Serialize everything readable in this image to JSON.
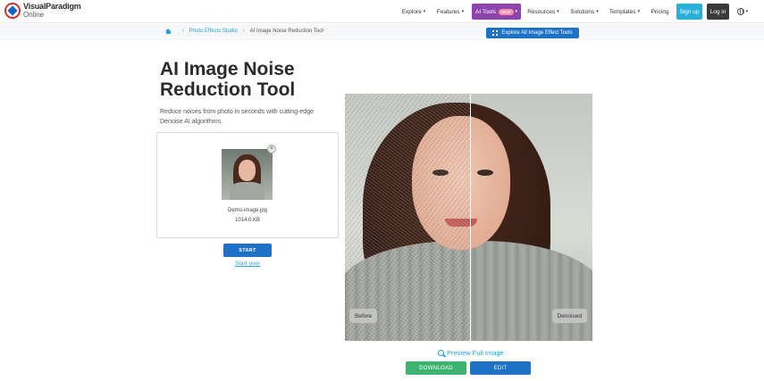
{
  "header": {
    "logo_line1": "VisualParadigm",
    "logo_line2": "Online",
    "nav": {
      "explore": "Explore",
      "features": "Features",
      "ai_tools": "AI Tools",
      "ai_badge": "NEW",
      "resources": "Resources",
      "solutions": "Solutions",
      "templates": "Templates",
      "pricing": "Pricing",
      "signup": "Sign up",
      "login": "Log in"
    }
  },
  "breadcrumb": {
    "item1": "Photo Effects Studio",
    "item2": "AI Image Noise Reduction Tool",
    "explore_button": "Explore All Image Effect Tools"
  },
  "main": {
    "title": "AI Image Noise Reduction Tool",
    "description": "Reduce noises from photo in seconds with cutting-edge Denoise AI algorithms.",
    "file": {
      "name": "Demo-image.jpg",
      "size": "1014.0 KB"
    },
    "start_button": "START",
    "start_over": "Start over"
  },
  "compare": {
    "before_label": "Before",
    "after_label": "Denoised"
  },
  "actions": {
    "preview": "Preview Full Image",
    "download": "DOWNLOAD",
    "edit": "EDIT"
  },
  "colors": {
    "primary": "#1d72c8",
    "ai_tools": "#8e44ad",
    "signup": "#2ab0d9",
    "download": "#3cb371",
    "link": "#28a0d8"
  }
}
